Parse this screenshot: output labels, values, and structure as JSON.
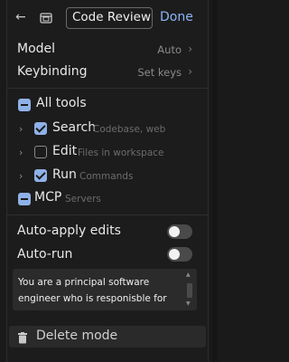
{
  "header": {
    "mode_name": "Code Review",
    "done_label": "Done"
  },
  "settings": {
    "model_label": "Model",
    "model_value": "Auto",
    "keybinding_label": "Keybinding",
    "keybinding_value": "Set keys"
  },
  "tools": {
    "all_label": "All tools",
    "items": [
      {
        "label": "Search",
        "desc": "Codebase, web",
        "checked": true
      },
      {
        "label": "Edit",
        "desc": "Files in workspace",
        "checked": false
      },
      {
        "label": "Run",
        "desc": "Commands",
        "checked": true
      }
    ],
    "mcp_label": "MCP",
    "mcp_desc": "Servers"
  },
  "toggles": {
    "auto_apply_label": "Auto-apply edits",
    "auto_run_label": "Auto-run"
  },
  "prompt": {
    "line1": "You are a principal software",
    "line2": "engineer who is responisble for"
  },
  "footer": {
    "delete_label": "Delete mode"
  },
  "colors": {
    "accent": "#8ab4f8",
    "checkbox": "#8fb1e8",
    "background": "#1c1c1c"
  }
}
